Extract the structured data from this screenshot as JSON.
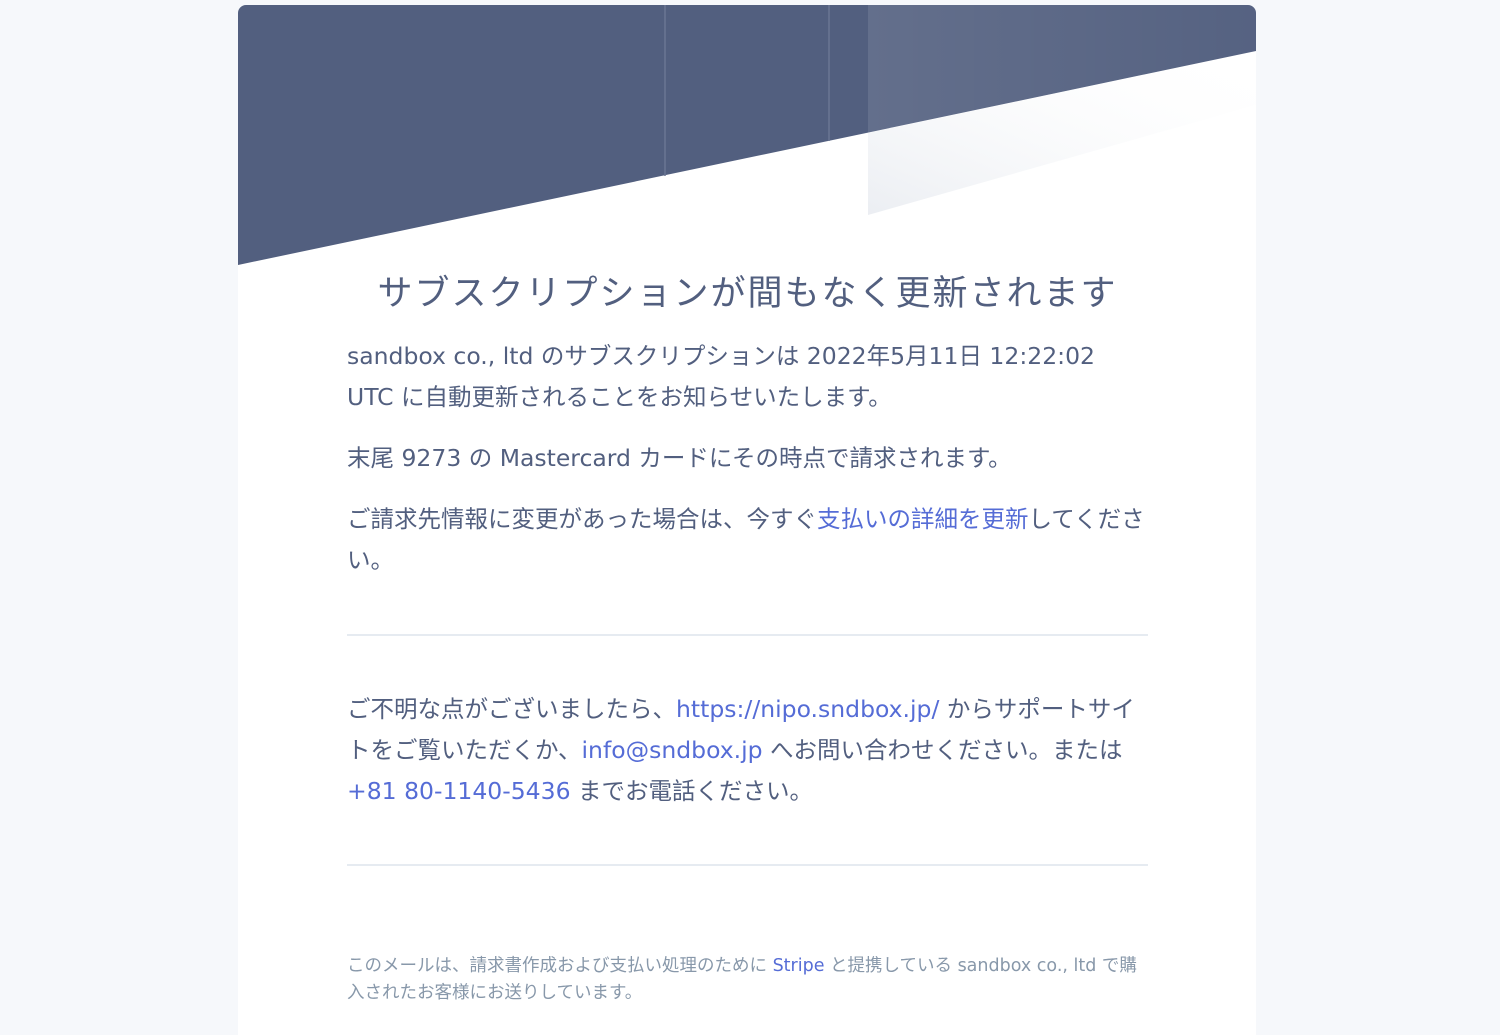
{
  "email": {
    "title": "サブスクリプションが間もなく更新されます",
    "renewal": {
      "before": "sandbox co., ltd のサブスクリプションは 2022年5月11日 12:22:02 UTC に自動更新されることをお知らせいたします。"
    },
    "card_notice": "末尾 9273 の Mastercard カードにその時点で請求されます。",
    "billing": {
      "before": "ご請求先情報に変更があった場合は、今すぐ",
      "link": "支払いの詳細を更新",
      "after": "してください。"
    },
    "support": {
      "part1": "ご不明な点がございましたら、",
      "url": "https://nipo.sndbox.jp/",
      "part2": " からサポートサイトをご覧いただくか、",
      "email": "info@sndbox.jp",
      "part3": " へお問い合わせください。または ",
      "phone": "+81 80-1140-5436",
      "part4": " までお電話ください。"
    },
    "footer": {
      "before": "このメールは、請求書作成および支払い処理のために ",
      "stripe": "Stripe",
      "after": " と提携している sandbox co., ltd で購入されたお客様にお送りしています。"
    }
  },
  "colors": {
    "header": "#525f7f",
    "link": "#556cd6",
    "text": "#525f7f",
    "muted": "#8898aa",
    "divider": "#e6ebf1"
  }
}
